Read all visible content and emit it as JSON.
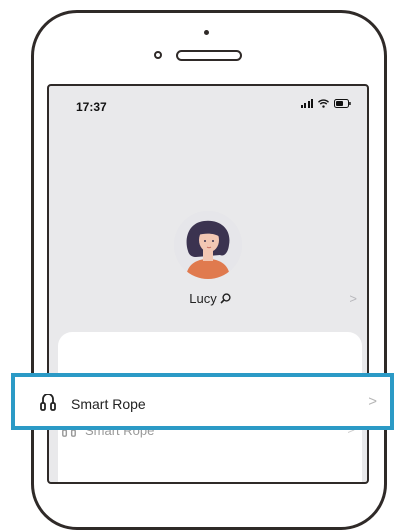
{
  "status_bar": {
    "time": "17:37",
    "signal_icon": "cellular-signal-icon",
    "wifi_icon": "wifi-icon",
    "battery_icon": "battery-icon"
  },
  "profile": {
    "name": "Lucy",
    "name_icon": "search-icon",
    "chevron": ">"
  },
  "menu": {
    "highlighted_item": {
      "label": "Smart Rope",
      "icon": "jump-rope-icon",
      "chevron": ">"
    },
    "partial_item": {
      "label": "Smart Rope",
      "icon": "jump-rope-icon",
      "chevron": ">"
    }
  },
  "colors": {
    "screen_bg": "#e9e9eb",
    "highlight_border": "#2b9ac6",
    "avatar_shirt": "#e07a4e",
    "avatar_hair": "#3b3350"
  }
}
